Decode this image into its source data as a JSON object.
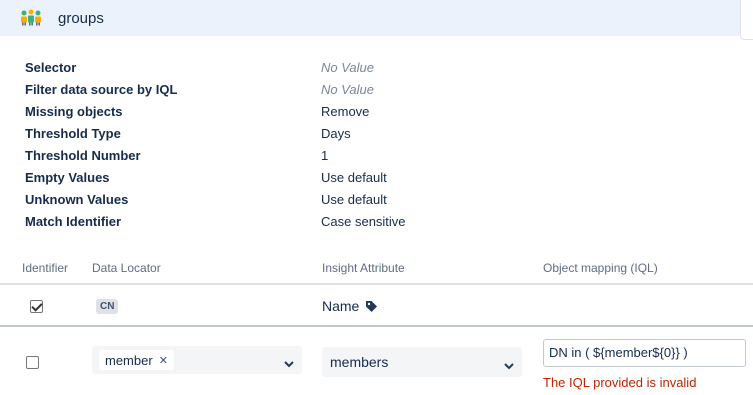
{
  "header": {
    "title": "groups",
    "icon": "groups-icon"
  },
  "properties": [
    {
      "label": "Selector",
      "value": "No Value",
      "empty": true
    },
    {
      "label": "Filter data source by IQL",
      "value": "No Value",
      "empty": true
    },
    {
      "label": "Missing objects",
      "value": "Remove",
      "empty": false
    },
    {
      "label": "Threshold Type",
      "value": "Days",
      "empty": false
    },
    {
      "label": "Threshold Number",
      "value": "1",
      "empty": false
    },
    {
      "label": "Empty Values",
      "value": "Use default",
      "empty": false
    },
    {
      "label": "Unknown Values",
      "value": "Use default",
      "empty": false
    },
    {
      "label": "Match Identifier",
      "value": "Case sensitive",
      "empty": false
    }
  ],
  "table": {
    "headers": {
      "identifier": "Identifier",
      "data_locator": "Data Locator",
      "insight_attribute": "Insight Attribute",
      "object_mapping": "Object mapping (IQL)"
    },
    "row1": {
      "identifier_checked": true,
      "data_locator_badge": "CN",
      "insight_attribute": "Name",
      "attribute_icon": "tag-icon"
    },
    "row2": {
      "identifier_checked": false,
      "data_locator_chip": "member",
      "insight_attribute_select": "members",
      "iql_value": "DN in ( ${member${0}} )",
      "error": "The IQL provided is invalid"
    }
  },
  "colors": {
    "header_bg": "#ebf2fb",
    "error": "#bf2600",
    "muted": "#7a869a"
  }
}
